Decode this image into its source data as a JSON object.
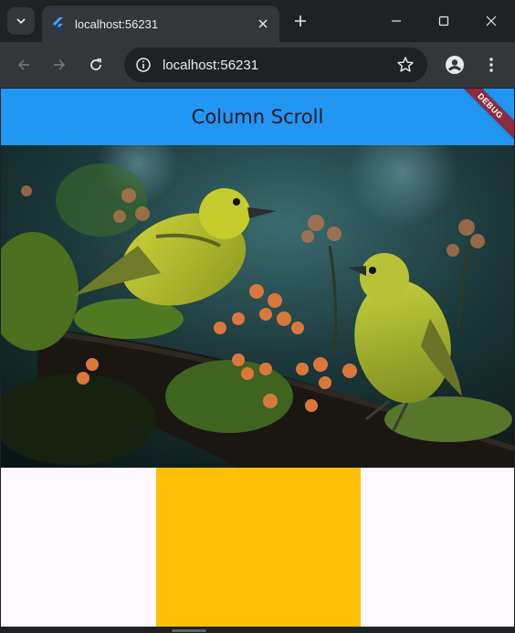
{
  "browser": {
    "tab": {
      "title": "localhost:56231"
    },
    "omnibox": {
      "url": "localhost:56231"
    },
    "icons": {
      "tab_search": "chevron-down-icon",
      "favicon": "flutter-logo-icon",
      "close": "close-icon",
      "new_tab": "plus-icon",
      "minimize": "minimize-icon",
      "maximize": "maximize-icon",
      "window_close": "close-icon",
      "back": "arrow-left-icon",
      "forward": "arrow-right-icon",
      "reload": "reload-icon",
      "site_info": "info-icon",
      "bookmark": "star-icon",
      "profile": "profile-icon",
      "menu": "more-vert-icon"
    },
    "colors": {
      "frame": "#202124",
      "toolbar": "#35363a"
    }
  },
  "app": {
    "appbar": {
      "title": "Column Scroll",
      "color": "#2196f3"
    },
    "debug_banner": {
      "label": "DEBUG",
      "color": "#8b2c3f"
    },
    "image": {
      "subject": "two yellow birds on a mossy branch with orange berries"
    },
    "box": {
      "color": "#ffc107"
    },
    "background": "#fdf7ff"
  }
}
